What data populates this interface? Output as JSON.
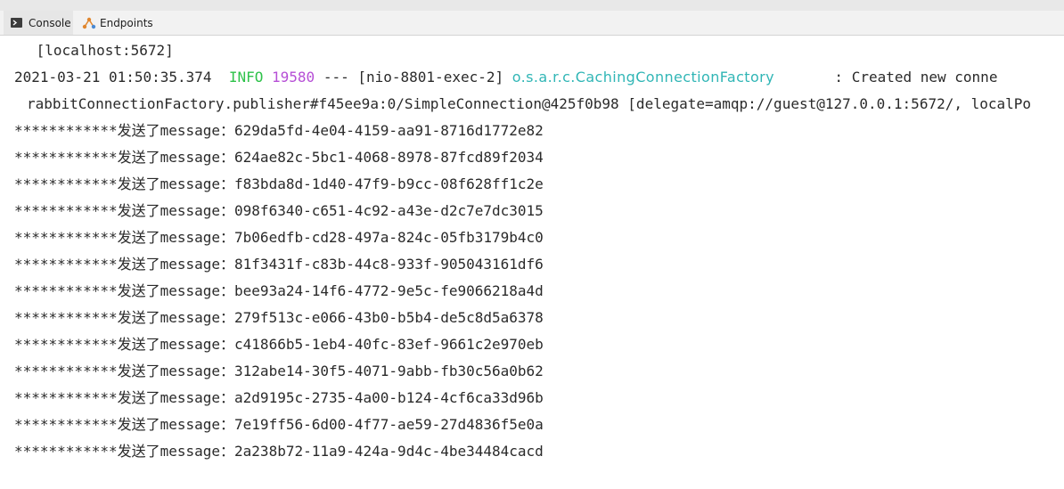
{
  "tabs": [
    {
      "label": "Console",
      "icon": "terminal-icon"
    },
    {
      "label": "Endpoints",
      "icon": "endpoints-icon"
    }
  ],
  "console": {
    "line1": " [localhost:5672]",
    "log": {
      "timestamp": "2021-03-21 01:50:35.374",
      "level": "INFO",
      "pid": "19580",
      "sep": "---",
      "thread": "[nio-8801-exec-2]",
      "logger": "o.s.a.r.c.CachingConnectionFactory",
      "message": ": Created new conne"
    },
    "line3": "rabbitConnectionFactory.publisher#f45ee9a:0/SimpleConnection@425f0b98 [delegate=amqp://guest@127.0.0.1:5672/, localPo",
    "message_prefix": "************发送了message：",
    "messages": [
      "629da5fd-4e04-4159-aa91-8716d1772e82",
      "624ae82c-5bc1-4068-8978-87fcd89f2034",
      "f83bda8d-1d40-47f9-b9cc-08f628ff1c2e",
      "098f6340-c651-4c92-a43e-d2c7e7dc3015",
      "7b06edfb-cd28-497a-824c-05fb3179b4c0",
      "81f3431f-c83b-44c8-933f-905043161df6",
      "bee93a24-14f6-4772-9e5c-fe9066218a4d",
      "279f513c-e066-43b0-b5b4-de5c8d5a6378",
      "c41866b5-1eb4-40fc-83ef-9661c2e970eb",
      "312abe14-30f5-4071-9abb-fb30c56a0b62",
      "a2d9195c-2735-4a00-b124-4cf6ca33d96b",
      "7e19ff56-6d00-4f77-ae59-27d4836f5e0a",
      "2a238b72-11a9-424a-9d4c-4be34484cacd"
    ]
  },
  "colors": {
    "info": "#2ec24a",
    "pid": "#b64fd6",
    "logger": "#31b6b6",
    "text": "#2a2a2a"
  }
}
